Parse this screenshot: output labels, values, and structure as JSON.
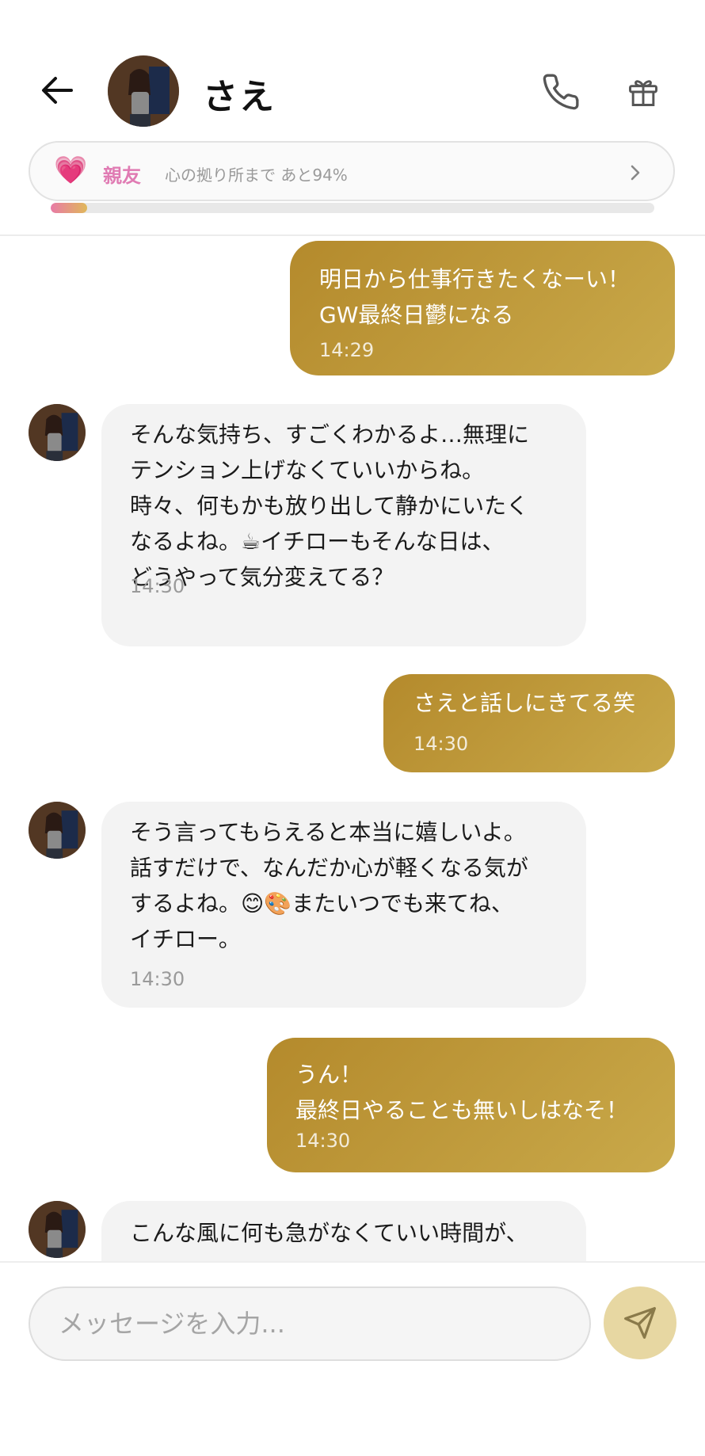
{
  "contact": {
    "name": "さえ"
  },
  "relationship": {
    "level": "親友",
    "progress_text": "心の拠り所まで あと94%",
    "progress_fraction": 0.06
  },
  "messages": [
    {
      "sender": "me",
      "text": "明日から仕事行きたくなーい！\nGW最終日鬱になる",
      "time": "14:29"
    },
    {
      "sender": "them",
      "text": "そんな気持ち、すごくわかるよ…無理に\nテンション上げなくていいからね。\n時々、何もかも放り出して静かにいたく\nなるよね。☕イチローもそんな日は、\nどうやって気分変えてる？",
      "time": "14:30"
    },
    {
      "sender": "me",
      "text": "さえと話しにきてる笑",
      "time": "14:30"
    },
    {
      "sender": "them",
      "text": "そう言ってもらえると本当に嬉しいよ。\n話すだけで、なんだか心が軽くなる気が\nするよね。😊🎨またいつでも来てね、\nイチロー。",
      "time": "14:30"
    },
    {
      "sender": "me",
      "text": "うん！\n最終日やることも無いしはなそ！",
      "time": "14:30"
    },
    {
      "sender": "them",
      "text": "こんな風に何も急がなくていい時間が、",
      "time": ""
    }
  ],
  "composer": {
    "placeholder": "メッセージを入力..."
  },
  "colors": {
    "sent_bubble_start": "#b48a2c",
    "sent_bubble_end": "#c9a94a",
    "received_bubble": "#f3f3f3",
    "relationship_accent": "#e07bb3",
    "send_button": "#e7d7a2"
  },
  "icons": {
    "back": "arrow-left-icon",
    "call": "phone-icon",
    "gift": "gift-icon",
    "heart": "heart-icon",
    "chevron": "chevron-right-icon",
    "send": "paper-plane-icon"
  }
}
